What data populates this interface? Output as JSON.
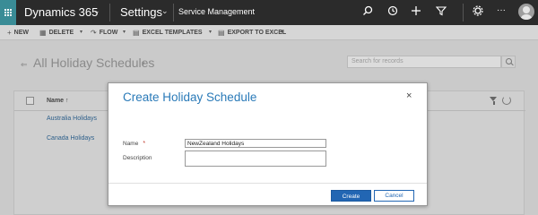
{
  "nav": {
    "app_title": "Dynamics 365",
    "area_title": "Settings",
    "subarea_title": "Service Management"
  },
  "icons": {
    "waffle": "app-launcher-icon",
    "search": "search-icon",
    "recent": "clock-icon",
    "new": "plus-icon",
    "filter": "filter-icon",
    "settings": "gear-icon",
    "more": "ellipsis-icon",
    "user": "user-avatar-icon"
  },
  "commands": {
    "new_label": "NEW",
    "delete_label": "DELETE",
    "flow_label": "FLOW",
    "excel_templates_label": "EXCEL TEMPLATES",
    "export_label": "EXPORT TO EXCEL"
  },
  "view": {
    "title": "All Holiday Schedules",
    "search_placeholder": "Search for records",
    "column_name": "Name ↑",
    "rows": [
      "Australia Holidays",
      "Canada Holidays"
    ]
  },
  "dialog": {
    "title": "Create Holiday Schedule",
    "close": "×",
    "name_label": "Name",
    "required_mark": "*",
    "name_value": "NewZealand Holidays",
    "description_label": "Description",
    "description_value": "",
    "create_label": "Create",
    "cancel_label": "Cancel"
  },
  "colors": {
    "topbar": "#2b2b2b",
    "accent_teal": "#3a8c96",
    "primary_blue": "#2266b3",
    "title_blue": "#2a7ab8"
  }
}
